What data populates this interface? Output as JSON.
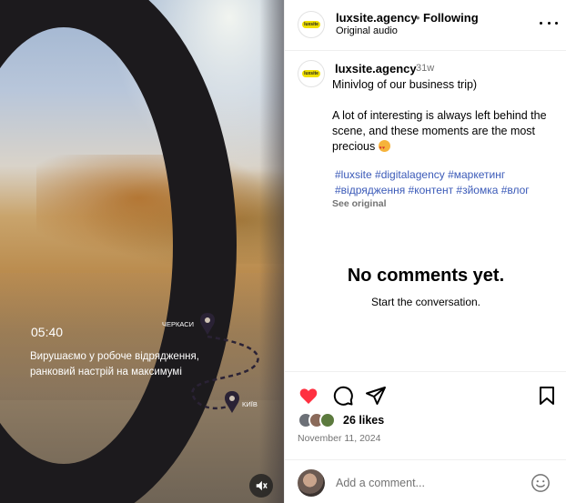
{
  "media": {
    "video_time": "05:40",
    "video_caption": "Вирушаємо у робоче відрядження, ранковий настрій на максимумі",
    "route_from": "ЧЕРКАСИ",
    "route_to": "КИЇВ",
    "mute_icon": "speaker-muted-icon"
  },
  "header": {
    "username": "luxsite.agency",
    "separator": "•",
    "follow_status": "Following",
    "audio": "Original audio",
    "logo_text": "luxsite"
  },
  "caption": {
    "username": "luxsite.agency",
    "time_ago": "31w",
    "text": "Minivlog of our business trip)\n\nA lot of interesting is always left behind the scene, and these moments are the most precious",
    "hashtags": "#luxsite #digitalagency #маркетинг #відрядження #контент #зйомка #влог",
    "see_original": "See original"
  },
  "comments": {
    "empty_title": "No comments yet.",
    "empty_subtitle": "Start the conversation."
  },
  "actions": {
    "liked": true,
    "like_color": "#ff3040",
    "likes": "26 likes",
    "date": "November 11, 2024"
  },
  "comment_box": {
    "placeholder": "Add a comment..."
  }
}
